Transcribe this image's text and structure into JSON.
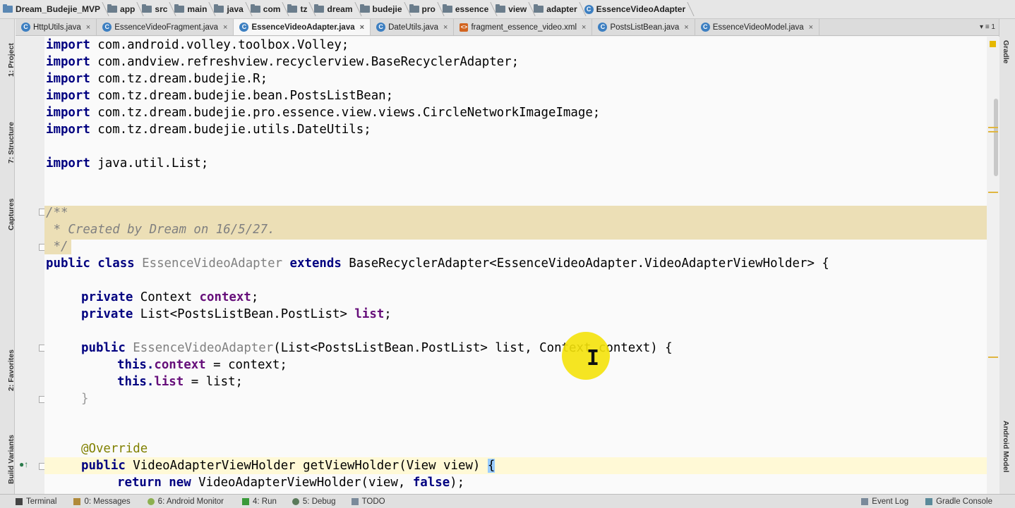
{
  "breadcrumb": {
    "items": [
      {
        "label": "Dream_Budejie_MVP",
        "icon": "project-folder-icon"
      },
      {
        "label": "app",
        "icon": "folder-icon"
      },
      {
        "label": "src",
        "icon": "folder-icon"
      },
      {
        "label": "main",
        "icon": "folder-icon"
      },
      {
        "label": "java",
        "icon": "folder-icon"
      },
      {
        "label": "com",
        "icon": "package-icon"
      },
      {
        "label": "tz",
        "icon": "package-icon"
      },
      {
        "label": "dream",
        "icon": "package-icon"
      },
      {
        "label": "budejie",
        "icon": "package-icon"
      },
      {
        "label": "pro",
        "icon": "package-icon"
      },
      {
        "label": "essence",
        "icon": "package-icon"
      },
      {
        "label": "view",
        "icon": "package-icon"
      },
      {
        "label": "adapter",
        "icon": "package-icon"
      },
      {
        "label": "EssenceVideoAdapter",
        "icon": "class-icon"
      }
    ]
  },
  "tabs": [
    {
      "label": "HttpUtils.java",
      "icon": "class-icon",
      "active": false
    },
    {
      "label": "EssenceVideoFragment.java",
      "icon": "class-icon",
      "active": false
    },
    {
      "label": "EssenceVideoAdapter.java",
      "icon": "class-icon",
      "active": true
    },
    {
      "label": "DateUtils.java",
      "icon": "class-icon",
      "active": false
    },
    {
      "label": "fragment_essence_video.xml",
      "icon": "xml-icon",
      "active": false
    },
    {
      "label": "PostsListBean.java",
      "icon": "class-icon",
      "active": false
    },
    {
      "label": "EssenceVideoModel.java",
      "icon": "class-icon",
      "active": false
    }
  ],
  "tab_close": "×",
  "tab_overflow": "▾ ≡ 1",
  "left_tools": {
    "project": "1: Project",
    "structure": "7: Structure",
    "captures": "Captures",
    "favorites": "2: Favorites",
    "build_variants": "Build Variants"
  },
  "right_tools": {
    "gradle": "Gradle",
    "android_model": "Android Model"
  },
  "code": {
    "l1_kw": "import",
    "l1": " com.android.volley.toolbox.Volley;",
    "l2_kw": "import",
    "l2": " com.andview.refreshview.recyclerview.BaseRecyclerAdapter;",
    "l3_kw": "import",
    "l3": " com.tz.dream.budejie.R;",
    "l4_kw": "import",
    "l4": " com.tz.dream.budejie.bean.PostsListBean;",
    "l5_kw": "import",
    "l5": " com.tz.dream.budejie.pro.essence.view.views.CircleNetworkImageImage;",
    "l6_kw": "import",
    "l6": " com.tz.dream.budejie.utils.DateUtils;",
    "l7_kw": "import",
    "l7": " java.util.List;",
    "c1": "/**",
    "c2": " * Created by Dream on 16/5/27.",
    "c3": " */",
    "cls_kw1": "public class ",
    "cls_name": "EssenceVideoAdapter",
    "cls_kw2": " extends ",
    "cls_rest": "BaseRecyclerAdapter<EssenceVideoAdapter.VideoAdapterViewHolder> {",
    "f1_kw": "private ",
    "f1_type": "Context ",
    "f1_name": "context",
    "f1_end": ";",
    "f2_kw": "private ",
    "f2_type": "List<PostsListBean.PostList> ",
    "f2_name": "list",
    "f2_end": ";",
    "ctor_kw": "public ",
    "ctor_name": "EssenceVideoAdapter",
    "ctor_rest": "(List<PostsListBean.PostList> list, Context context) {",
    "a1_kw": "this.",
    "a1_fld": "context",
    "a1_rest": " = context;",
    "a2_kw": "this.",
    "a2_fld": "list",
    "a2_rest": " = list;",
    "close": "}",
    "ann": "@Override",
    "m_kw": "public ",
    "m_rest": "VideoAdapterViewHolder getViewHolder(View view) ",
    "m_brace": "{",
    "r_kw1": "return new ",
    "r_rest": "VideoAdapterViewHolder(view, ",
    "r_kw2": "false",
    "r_end": ");"
  },
  "bottom": {
    "terminal": "Terminal",
    "messages": "0: Messages",
    "android_monitor": "6: Android Monitor",
    "run": "4: Run",
    "debug": "5: Debug",
    "todo": "TODO",
    "event_log": "Event Log",
    "gradle_console": "Gradle Console"
  },
  "colors": {
    "keyword": "#000080",
    "field": "#660e7a",
    "comment": "#808080",
    "annotation": "#808000",
    "comment_highlight": "#ecdfb6",
    "cursor_highlight": "#f4e20a"
  }
}
